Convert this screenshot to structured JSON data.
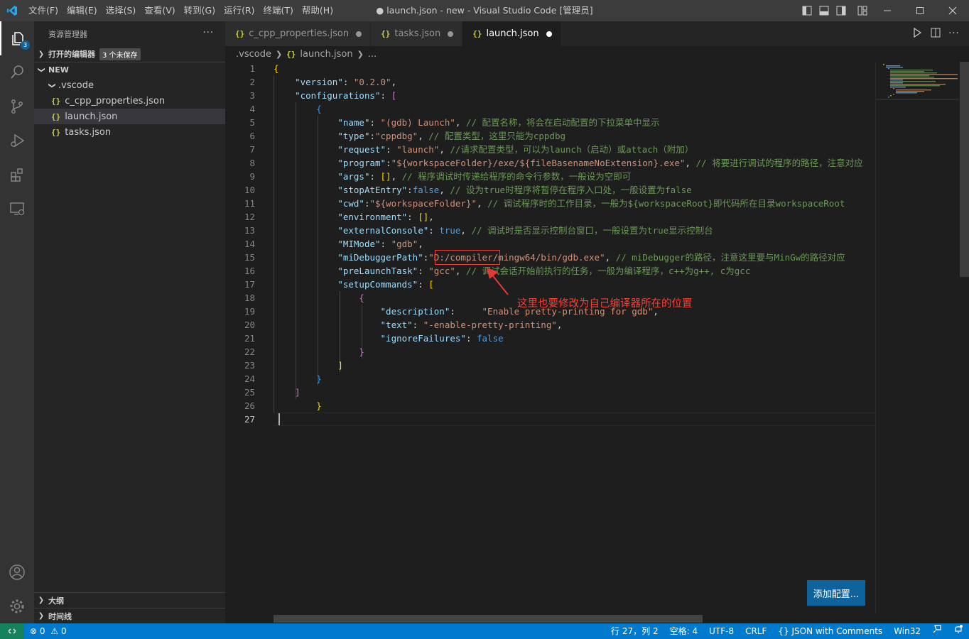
{
  "window": {
    "title": "● launch.json - new - Visual Studio Code [管理员]",
    "menu": [
      "文件(F)",
      "编辑(E)",
      "选择(S)",
      "查看(V)",
      "转到(G)",
      "运行(R)",
      "终端(T)",
      "帮助(H)"
    ]
  },
  "activity_bar": {
    "explorer_badge": "3"
  },
  "sidebar": {
    "title": "资源管理器",
    "more": "···",
    "open_editors": {
      "label": "打开的编辑器",
      "badge": "3 个未保存"
    },
    "folder": {
      "label": "NEW"
    },
    "subfolder": {
      "label": ".vscode"
    },
    "files": [
      {
        "name": "c_cpp_properties.json",
        "icon": "{}"
      },
      {
        "name": "launch.json",
        "icon": "{}"
      },
      {
        "name": "tasks.json",
        "icon": "{}"
      }
    ],
    "outline": "大纲",
    "timeline": "时间线"
  },
  "tabs": [
    {
      "icon": "{}",
      "label": "c_cpp_properties.json"
    },
    {
      "icon": "{}",
      "label": "tasks.json"
    },
    {
      "icon": "{}",
      "label": "launch.json"
    }
  ],
  "breadcrumb": {
    "folder": ".vscode",
    "icon": "{}",
    "file": "launch.json",
    "more": "..."
  },
  "editor": {
    "annotation": "这里也要修改为自己编译器所在的位置",
    "add_config_button": "添加配置...",
    "lines": [
      [
        [
          "{",
          "y"
        ]
      ],
      [
        [
          "    ",
          ""
        ],
        [
          "\"version\"",
          "k"
        ],
        [
          ": ",
          "d"
        ],
        [
          "\"0.2.0\"",
          "s"
        ],
        [
          ",",
          "d"
        ]
      ],
      [
        [
          "    ",
          ""
        ],
        [
          "\"configurations\"",
          "k"
        ],
        [
          ": ",
          "d"
        ],
        [
          "[",
          "p"
        ]
      ],
      [
        [
          "        ",
          ""
        ],
        [
          "{",
          "bl"
        ]
      ],
      [
        [
          "            ",
          ""
        ],
        [
          "\"name\"",
          "k"
        ],
        [
          ": ",
          "d"
        ],
        [
          "\"(gdb) Launch\"",
          "s"
        ],
        [
          ", ",
          "d"
        ],
        [
          "// 配置名称，将会在启动配置的下拉菜单中显示",
          "c"
        ]
      ],
      [
        [
          "            ",
          ""
        ],
        [
          "\"type\"",
          "k"
        ],
        [
          ":",
          "d"
        ],
        [
          "\"cppdbg\"",
          "s"
        ],
        [
          ", ",
          "d"
        ],
        [
          "// 配置类型，这里只能为cppdbg",
          "c"
        ]
      ],
      [
        [
          "            ",
          ""
        ],
        [
          "\"request\"",
          "k"
        ],
        [
          ": ",
          "d"
        ],
        [
          "\"launch\"",
          "s"
        ],
        [
          ", ",
          "d"
        ],
        [
          "//请求配置类型，可以为launch（启动）或attach（附加）",
          "c"
        ]
      ],
      [
        [
          "            ",
          ""
        ],
        [
          "\"program\"",
          "k"
        ],
        [
          ":",
          "d"
        ],
        [
          "\"${workspaceFolder}/exe/${fileBasenameNoExtension}.exe\"",
          "s"
        ],
        [
          ", ",
          "d"
        ],
        [
          "// 将要进行调试的程序的路径，注意对应",
          "c"
        ]
      ],
      [
        [
          "            ",
          ""
        ],
        [
          "\"args\"",
          "k"
        ],
        [
          ": ",
          "d"
        ],
        [
          "[]",
          "y"
        ],
        [
          ", ",
          "d"
        ],
        [
          "// 程序调试时传递给程序的命令行参数，一般设为空即可",
          "c"
        ]
      ],
      [
        [
          "            ",
          ""
        ],
        [
          "\"stopAtEntry\"",
          "k"
        ],
        [
          ":",
          "d"
        ],
        [
          "false",
          "b"
        ],
        [
          ", ",
          "d"
        ],
        [
          "// 设为true时程序将暂停在程序入口处，一般设置为false",
          "c"
        ]
      ],
      [
        [
          "            ",
          ""
        ],
        [
          "\"cwd\"",
          "k"
        ],
        [
          ":",
          "d"
        ],
        [
          "\"${workspaceFolder}\"",
          "s"
        ],
        [
          ", ",
          "d"
        ],
        [
          "// 调试程序时的工作目录，一般为${workspaceRoot}即代码所在目录workspaceRoot",
          "c"
        ]
      ],
      [
        [
          "            ",
          ""
        ],
        [
          "\"environment\"",
          "k"
        ],
        [
          ": ",
          "d"
        ],
        [
          "[]",
          "y"
        ],
        [
          ",",
          "d"
        ]
      ],
      [
        [
          "            ",
          ""
        ],
        [
          "\"externalConsole\"",
          "k"
        ],
        [
          ": ",
          "d"
        ],
        [
          "true",
          "b"
        ],
        [
          ", ",
          "d"
        ],
        [
          "// 调试时是否显示控制台窗口，一般设置为true显示控制台",
          "c"
        ]
      ],
      [
        [
          "            ",
          ""
        ],
        [
          "\"MIMode\"",
          "k"
        ],
        [
          ": ",
          "d"
        ],
        [
          "\"gdb\"",
          "s"
        ],
        [
          ",",
          "d"
        ]
      ],
      [
        [
          "            ",
          ""
        ],
        [
          "\"miDebuggerPath\"",
          "k"
        ],
        [
          ":",
          "d"
        ],
        [
          "\"D:/compiler/mingw64/bin/gdb.exe\"",
          "s"
        ],
        [
          ", ",
          "d"
        ],
        [
          "// miDebugger的路径，注意这里要与MinGw的路径对应",
          "c"
        ]
      ],
      [
        [
          "            ",
          ""
        ],
        [
          "\"preLaunchTask\"",
          "k"
        ],
        [
          ": ",
          "d"
        ],
        [
          "\"gcc\"",
          "s"
        ],
        [
          ", ",
          "d"
        ],
        [
          "// 调试会话开始前执行的任务，一般为编译程序，c++为g++, c为gcc",
          "c"
        ]
      ],
      [
        [
          "            ",
          ""
        ],
        [
          "\"setupCommands\"",
          "k"
        ],
        [
          ": ",
          "d"
        ],
        [
          "[",
          "y"
        ]
      ],
      [
        [
          "                ",
          ""
        ],
        [
          "{",
          "p"
        ]
      ],
      [
        [
          "                    ",
          ""
        ],
        [
          "\"description\"",
          "k"
        ],
        [
          ":     ",
          "d"
        ],
        [
          "\"Enable pretty-printing for gdb\"",
          "s"
        ],
        [
          ",",
          "d"
        ]
      ],
      [
        [
          "                    ",
          ""
        ],
        [
          "\"text\"",
          "k"
        ],
        [
          ": ",
          "d"
        ],
        [
          "\"-enable-pretty-printing\"",
          "s"
        ],
        [
          ",",
          "d"
        ]
      ],
      [
        [
          "                    ",
          ""
        ],
        [
          "\"ignoreFailures\"",
          "k"
        ],
        [
          ": ",
          "d"
        ],
        [
          "false",
          "b"
        ]
      ],
      [
        [
          "                ",
          ""
        ],
        [
          "}",
          "p"
        ]
      ],
      [
        [
          "            ",
          ""
        ],
        [
          "]",
          "y"
        ]
      ],
      [
        [
          "        ",
          ""
        ],
        [
          "}",
          "bl"
        ]
      ],
      [
        [
          "    ",
          ""
        ],
        [
          "]",
          "p"
        ]
      ],
      [
        [
          "        ",
          ""
        ],
        [
          "}",
          "y"
        ]
      ],
      [
        [
          "",
          ""
        ]
      ]
    ]
  },
  "statusbar": {
    "errors": "0",
    "warnings": "0",
    "position": "行 27，列 2",
    "spaces": "空格: 4",
    "encoding": "UTF-8",
    "eol": "CRLF",
    "language": "{} JSON with Comments",
    "platform": "Win32"
  },
  "colors": {
    "accent": "#007acc",
    "annotation": "#e53935"
  }
}
